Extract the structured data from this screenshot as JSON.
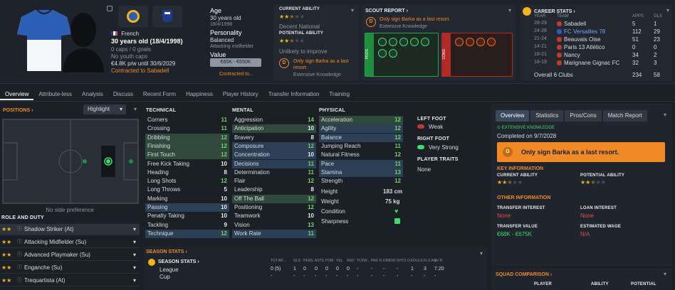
{
  "player": {
    "nationality": "French",
    "age_line": "30 years old (18/4/1998)",
    "caps_line": "0 caps / 0 goals",
    "youth_caps": "No youth caps",
    "wage_line": "€4.8K p/w until 30/6/2029",
    "contract_line": "Contracted to Sabadell"
  },
  "header_info": {
    "age_label": "Age",
    "age_value": "30 years old",
    "dob": "18/4/1998",
    "personality_label": "Personality",
    "personality_value": "Balanced",
    "position": "Attacking midfielder",
    "value_label": "Value",
    "value_range": "€65K - €650K",
    "contracted_to": "Contracted to..."
  },
  "ability": {
    "current_label": "CURRENT ABILITY",
    "current_desc": "Decent National",
    "potential_label": "POTENTIAL ABILITY",
    "potential_desc": "Unlikely to improve",
    "advice": "Only sign Barka as a last resort.",
    "knowledge": "Extensive Knowledge"
  },
  "scout_report": {
    "title": "SCOUT REPORT",
    "advice": "Only sign Barka as a last resort.",
    "knowledge": "Extensive Knowledge",
    "pros_label": "PROS",
    "cons_label": "CONS"
  },
  "career": {
    "title": "CAREER STATS",
    "col_year": "YEAR",
    "col_team": "TEAM",
    "col_apps": "APPS",
    "col_gls": "GLS",
    "rows": [
      {
        "year": "28-29",
        "team": "Sabadell",
        "apps": "5",
        "gls": "1"
      },
      {
        "year": "24-28",
        "team": "FC Versailles 78",
        "apps": "112",
        "gls": "29"
      },
      {
        "year": "21-24",
        "team": "Beauvais Oise",
        "apps": "51",
        "gls": "23"
      },
      {
        "year": "14-21",
        "team": "Paris 13 Atlético",
        "apps": "0",
        "gls": "0"
      },
      {
        "year": "18-21",
        "team": "Nancy",
        "apps": "34",
        "gls": "2"
      },
      {
        "year": "18-19",
        "team": "Marignane Gignac FC",
        "apps": "32",
        "gls": "3"
      }
    ],
    "overall_label": "Overall 6 Clubs",
    "overall_apps": "234",
    "overall_gls": "58"
  },
  "tabs": [
    "Overview",
    "Attribute-less",
    "Analysis",
    "Discuss",
    "Recent Form",
    "Happiness",
    "Player History",
    "Transfer Information",
    "Training"
  ],
  "positions": {
    "title": "POSITIONS",
    "highlight": "Highlight",
    "no_side": "No side preference",
    "role_title": "ROLE AND DUTY",
    "roles": [
      {
        "name": "Shadow Striker (At)",
        "stars": 2
      },
      {
        "name": "Attacking Midfielder (Su)",
        "stars": 2
      },
      {
        "name": "Advanced Playmaker (Su)",
        "stars": 2
      },
      {
        "name": "Enganche (Su)",
        "stars": 2
      },
      {
        "name": "Trequartista (At)",
        "stars": 2
      }
    ]
  },
  "technical": {
    "title": "TECHNICAL",
    "rows": [
      {
        "name": "Corners",
        "value": "11"
      },
      {
        "name": "Crossing",
        "value": "11"
      },
      {
        "name": "Dribbling",
        "value": "12"
      },
      {
        "name": "Finishing",
        "value": "12"
      },
      {
        "name": "First Touch",
        "value": "12"
      },
      {
        "name": "Free Kick Taking",
        "value": "10"
      },
      {
        "name": "Heading",
        "value": "8"
      },
      {
        "name": "Long Shots",
        "value": "12"
      },
      {
        "name": "Long Throws",
        "value": "5"
      },
      {
        "name": "Marking",
        "value": "10"
      },
      {
        "name": "Passing",
        "value": "10"
      },
      {
        "name": "Penalty Taking",
        "value": "10"
      },
      {
        "name": "Tackling",
        "value": "9"
      },
      {
        "name": "Technique",
        "value": "12"
      }
    ]
  },
  "mental": {
    "title": "MENTAL",
    "rows": [
      {
        "name": "Aggression",
        "value": "14"
      },
      {
        "name": "Anticipation",
        "value": "10"
      },
      {
        "name": "Bravery",
        "value": "8"
      },
      {
        "name": "Composure",
        "value": "12"
      },
      {
        "name": "Concentration",
        "value": "10"
      },
      {
        "name": "Decisions",
        "value": "11"
      },
      {
        "name": "Determination",
        "value": "11"
      },
      {
        "name": "Flair",
        "value": "12"
      },
      {
        "name": "Leadership",
        "value": "8"
      },
      {
        "name": "Off The Ball",
        "value": "12"
      },
      {
        "name": "Positioning",
        "value": "12"
      },
      {
        "name": "Teamwork",
        "value": "10"
      },
      {
        "name": "Vision",
        "value": "13"
      },
      {
        "name": "Work Rate",
        "value": "11"
      }
    ]
  },
  "physical": {
    "title": "PHYSICAL",
    "rows": [
      {
        "name": "Acceleration",
        "value": "12"
      },
      {
        "name": "Agility",
        "value": "12"
      },
      {
        "name": "Balance",
        "value": "12"
      },
      {
        "name": "Jumping Reach",
        "value": "11"
      },
      {
        "name": "Natural Fitness",
        "value": "12"
      },
      {
        "name": "Pace",
        "value": "11"
      },
      {
        "name": "Stamina",
        "value": "13"
      },
      {
        "name": "Strength",
        "value": "12"
      }
    ],
    "height_label": "Height",
    "height_value": "183 cm",
    "weight_label": "Weight",
    "weight_value": "75 kg",
    "condition_label": "Condition",
    "sharpness_label": "Sharpness"
  },
  "feet": {
    "left_label": "LEFT FOOT",
    "left_value": "Weak",
    "right_label": "RIGHT FOOT",
    "right_value": "Very Strong",
    "traits_label": "PLAYER TRAITS",
    "traits_value": "None"
  },
  "season": {
    "title": "SEASON STATS",
    "sub_title": "SEASON STATS",
    "columns": [
      "TOT AP...",
      "GLS",
      "PENS",
      "ASTS",
      "POM",
      "YEL",
      "RED",
      "TCKW...",
      "PAS %",
      "DRB/90",
      "SHTS O...",
      "FOULS",
      "FLS AG",
      "AV R"
    ],
    "rows": [
      {
        "name": "League",
        "values": [
          "0 (5)",
          "1",
          "0",
          "0",
          "0",
          "0",
          "0",
          "-",
          "-",
          "-",
          "-",
          "1",
          "3",
          "7.20"
        ]
      },
      {
        "name": "Cup",
        "values": [
          "-",
          "-",
          "-",
          "-",
          "-",
          "-",
          "-",
          "-",
          "-",
          "-",
          "-",
          "-",
          "-",
          "-"
        ]
      }
    ]
  },
  "overview": {
    "tabs": [
      "Overview",
      "Statistics",
      "Pros/Cons",
      "Match Report"
    ],
    "knowledge": "EXTENSIVE KNOWLEDGE",
    "completed": "Completed on 9/7/2028",
    "advice": "Only sign Barka as a last resort.",
    "key_title": "KEY INFORMATION",
    "current_label": "CURRENT ABILITY",
    "potential_label": "POTENTIAL ABILITY",
    "other_title": "OTHER INFORMATION",
    "transfer_interest_label": "TRANSFER INTEREST",
    "transfer_interest_value": "None",
    "loan_interest_label": "LOAN INTEREST",
    "loan_interest_value": "None",
    "transfer_value_label": "TRANSFER VALUE",
    "transfer_value": "€68K - €675K",
    "wage_label": "ESTIMATED WAGE",
    "wage_value": "N/A",
    "squad_title": "SQUAD COMPARISON",
    "squad_cols": [
      "PLAYER",
      "ABILITY",
      "POTENTIAL"
    ]
  },
  "colors": {
    "accent_orange": "#f08a24",
    "green": "#3ddc6a",
    "red": "#e34b4b"
  }
}
